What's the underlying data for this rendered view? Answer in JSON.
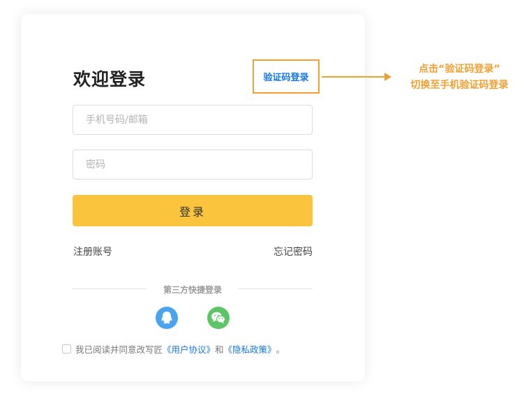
{
  "login": {
    "title": "欢迎登录",
    "switch_link": "验证码登录",
    "account_placeholder": "手机号码/邮箱",
    "password_placeholder": "密码",
    "submit_label": "登录",
    "register_link": "注册账号",
    "forgot_link": "忘记密码",
    "third_party_label": "第三方快捷登录",
    "social": {
      "qq_color": "#4aa3f0",
      "wechat_color": "#5cc565"
    },
    "agreement": {
      "prefix": "我已阅读并同意改写匠",
      "user_agreement": "《用户协议》",
      "conjunction": "和",
      "privacy_policy": "《隐私政策》",
      "suffix": "。"
    }
  },
  "annotation": {
    "line1": "点击“验证码登录”",
    "line2": "切换至手机验证码登录"
  },
  "colors": {
    "accent": "#fac43c",
    "link": "#1677e0",
    "annotation": "#f0a030"
  }
}
